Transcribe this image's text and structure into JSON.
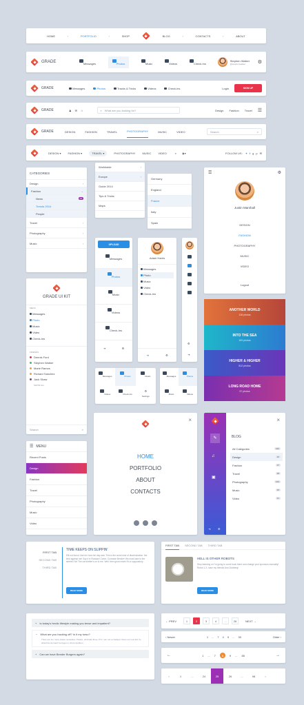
{
  "nav1": {
    "items": [
      "HOME",
      "PORTFOLIO",
      "SHOP",
      "BLOG",
      "CONTACTS",
      "ABOUT"
    ]
  },
  "nav2": {
    "brand": "GRADE",
    "tabs": [
      "Messages",
      "Photos",
      "Music",
      "Videos",
      "Check-Ins"
    ],
    "user_name": "Stephen Walker",
    "user_sub": "@stephenwalker"
  },
  "nav3": {
    "brand": "GRADE",
    "items": [
      "Messages",
      "Photos",
      "Tracks & Tricks",
      "Videos",
      "Check-ins"
    ],
    "login": "Login",
    "signup": "SIGN UP"
  },
  "nav4": {
    "brand": "GRADE",
    "search_placeholder": "What are you looking for?",
    "links": [
      "Design",
      "Fashion",
      "Travel"
    ]
  },
  "nav5": {
    "brand": "GRADE",
    "items": [
      "DESIGN",
      "FASHION",
      "TRAVEL",
      "PHOTOGRAPHY",
      "MUSIC",
      "VIDEO"
    ],
    "search_placeholder": "Search"
  },
  "nav6": {
    "items": [
      "DESIGN ▾",
      "FASHION ▾",
      "TRAVEL ▾",
      "PHOTOGRAPHY",
      "MUSIC",
      "VIDEO"
    ],
    "follow": "FOLLOW US:"
  },
  "categories": {
    "title": "CATEGORIES",
    "items": [
      "Design",
      "Fashion",
      "News",
      "Trends 2014",
      "People",
      "Travel",
      "Photography",
      "Music"
    ],
    "news_badge": "23"
  },
  "dropdown": {
    "col1": [
      "Worldwide",
      "Europe",
      "Guide 2014",
      "Tips & Tricks",
      "Maps"
    ],
    "col2": [
      "Germany",
      "England",
      "France",
      "Italy",
      "Spain"
    ]
  },
  "profile": {
    "name": "Justin Marshall",
    "items": [
      "DESIGN",
      "FASHION",
      "PHOTOGRAPHY",
      "MUSIC",
      "VIDEO"
    ],
    "logout": "Logout"
  },
  "upload": {
    "button": "UPLOAD",
    "items": [
      "Messages",
      "Photos",
      "Music",
      "Videos",
      "Check-Ins"
    ]
  },
  "adam": {
    "name": "Adam Harris",
    "items": [
      "Messages",
      "Photo",
      "Music",
      "Video",
      "Check-Ins"
    ]
  },
  "gallery": [
    {
      "title": "ANOTHER WORLD",
      "sub": "118 photos",
      "color1": "#e2733b",
      "color2": "#b5463a"
    },
    {
      "title": "INTO THE SEA",
      "sub": "109 photos",
      "color1": "#1eb7c9",
      "color2": "#2d7bd1"
    },
    {
      "title": "HIGHER & HIGHER",
      "sub": "812 photos",
      "color1": "#3a5bc8",
      "color2": "#6a36b8"
    },
    {
      "title": "LONG ROAD HOME",
      "sub": "97 photos",
      "color1": "#7a2fb0",
      "color2": "#b53a91"
    }
  ],
  "uikit": {
    "title": "GRADE UI KIT",
    "menu_label": "MENU",
    "items": [
      "Messages",
      "Photo",
      "Music",
      "Video",
      "Check-Ins"
    ],
    "friends_label": "FRIENDS",
    "friends": [
      "Dennis Ford",
      "Stephen Walker",
      "Marie Ramos",
      "Richard Sanchez",
      "Jack Shaw"
    ],
    "show_all": "SHOW ALL",
    "search_placeholder": "Search"
  },
  "icon_grid": {
    "labels": [
      "Messages",
      "Photos",
      "Music",
      "Videos",
      "Check-Ins",
      "Settings"
    ]
  },
  "icon_grid2": {
    "labels": [
      "Messages",
      "Photos",
      "Music",
      "Videos"
    ]
  },
  "menu_side": {
    "title": "MENU",
    "items": [
      "Recent Posts",
      "Design",
      "Fashion",
      "Travel",
      "Photography",
      "Music",
      "Video"
    ]
  },
  "modal_menu": {
    "items": [
      "HOME",
      "PORTFOLIO",
      "ABOUT",
      "CONTACTS"
    ]
  },
  "blog": {
    "title": "BLOG",
    "items": [
      {
        "name": "All Categories",
        "count": "240"
      },
      {
        "name": "Design",
        "count": "46"
      },
      {
        "name": "Fashion",
        "count": "37"
      },
      {
        "name": "Travel",
        "count": "38"
      },
      {
        "name": "Photography",
        "count": "163"
      },
      {
        "name": "Music",
        "count": "35"
      },
      {
        "name": "Video",
        "count": "41"
      }
    ]
  },
  "vtabs": {
    "tabs": [
      "FIRST TAB",
      "SECOND TAB",
      "THIRD TAB"
    ],
    "title": "TIME KEEPS ON SLIPPIN'",
    "body": "Elit not found. Ask her how her day was. This is the worst kind of discrimination: the kind against me! Say it in Russian! Come, Comrade Bender! We must take to the streets! No! The cat shelter's on to me. Well, then good news! It's a suppository.",
    "button": "READ MORE"
  },
  "htabs": {
    "tabs": [
      "FIRST TAB",
      "SECOND TAB",
      "THIRD TAB"
    ],
    "title": "HELL IS OTHER ROBOTS",
    "body": "Stop listening on I'm going to come back there and change your sponsors manually! Robot 1-X, save my friends! And Zoidberg!",
    "button": "READ MORE"
  },
  "faq": {
    "q1": "Is today's hectic lifestyle making you tense and impatient?",
    "q2": "What are you hacking off? Is it my torso?",
    "a2": "There are too many states nowadays. Please, eliminate three. P.S. I am not a crackpot. Does our new kid, he afraid his stomach be begun in third condition.",
    "q3": "Can we have Bender Burgers again?"
  },
  "pager1": {
    "prev": "← PREV",
    "pages": [
      "1",
      "2",
      "3",
      "4",
      "...",
      "26"
    ],
    "next": "NEXT →"
  },
  "pager2": {
    "newer": "‹ Newer",
    "pages": [
      "1",
      "...",
      "7",
      "8",
      "9",
      "...",
      "30"
    ],
    "older": "Older ›"
  },
  "pager3": {
    "pages": [
      "1",
      "...",
      "7",
      "8",
      "9",
      "...",
      "85"
    ]
  },
  "pager4": {
    "pages": [
      "1",
      "...",
      "24",
      "25",
      "26",
      "...",
      "98"
    ]
  }
}
